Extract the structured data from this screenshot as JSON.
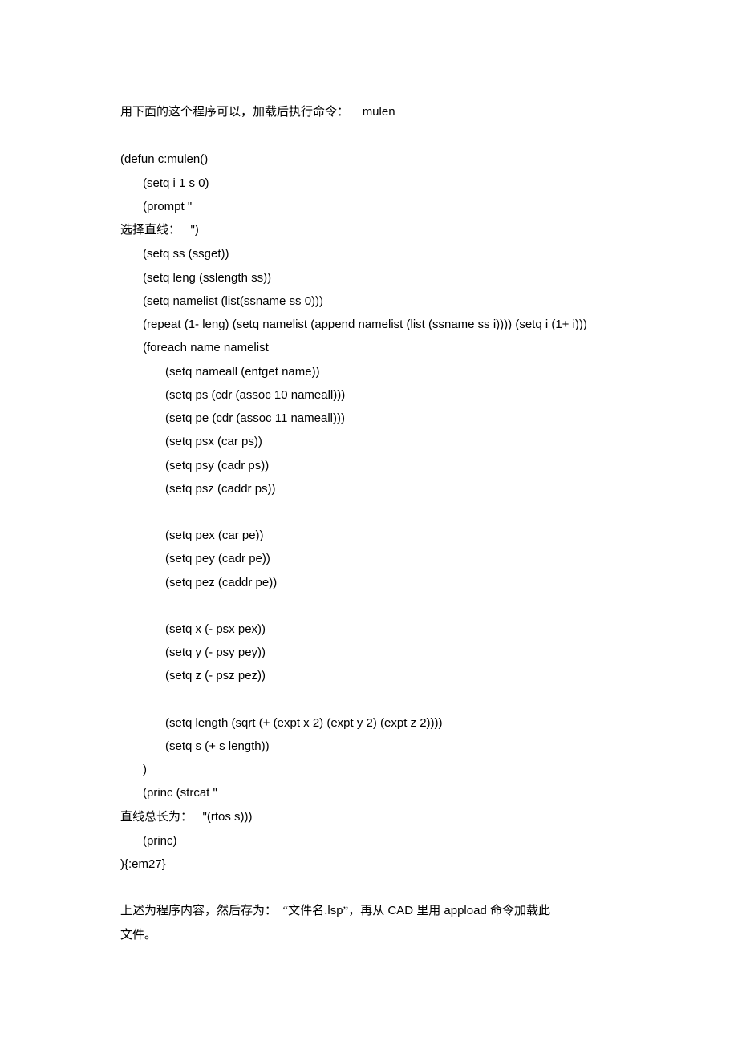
{
  "intro": {
    "cn_part": "用下面的这个程序可以，加载后执行命令：",
    "cmd": "mulen"
  },
  "code": {
    "l1": "(defun c:mulen()",
    "l2": "(setq i 1 s 0)",
    "l3": "(prompt \"",
    "l4_cn": "选择直线：",
    "l4_en": "\")",
    "l5": "(setq ss (ssget))",
    "l6": "(setq leng (sslength ss))",
    "l7": "(setq namelist (list(ssname ss 0)))",
    "l8": "(repeat (1- leng) (setq namelist (append namelist (list (ssname ss i)))) (setq i (1+ i)))",
    "l9": "(foreach name namelist",
    "l10": "(setq nameall (entget name))",
    "l11": "(setq ps (cdr (assoc 10 nameall)))",
    "l12": "(setq pe (cdr (assoc 11 nameall)))",
    "l13": "(setq psx (car ps))",
    "l14": "(setq psy (cadr ps))",
    "l15": "(setq psz (caddr ps))",
    "l16": "(setq pex (car pe))",
    "l17": "(setq pey (cadr pe))",
    "l18": "(setq pez (caddr pe))",
    "l19": "(setq x (- psx pex))",
    "l20": "(setq y (- psy pey))",
    "l21": "(setq z (- psz pez))",
    "l22": "(setq length (sqrt (+ (expt x 2) (expt y 2) (expt z 2))))",
    "l23": "(setq s (+ s length))",
    "l24": ")",
    "l25": "(princ (strcat \"",
    "l26_cn": "直线总长为：",
    "l26_en": "\"(rtos s)))",
    "l27": "(princ)",
    "l28": "){:em27}"
  },
  "outro": {
    "p1a": "上述为程序内容，然后存为：",
    "p1b": "“文件名",
    "p1c": ".lsp",
    "p1d": "”，再从",
    "p1e": " CAD ",
    "p1f": "里用",
    "p1g": " appload ",
    "p1h": "命令加载此",
    "p2": "文件。"
  }
}
